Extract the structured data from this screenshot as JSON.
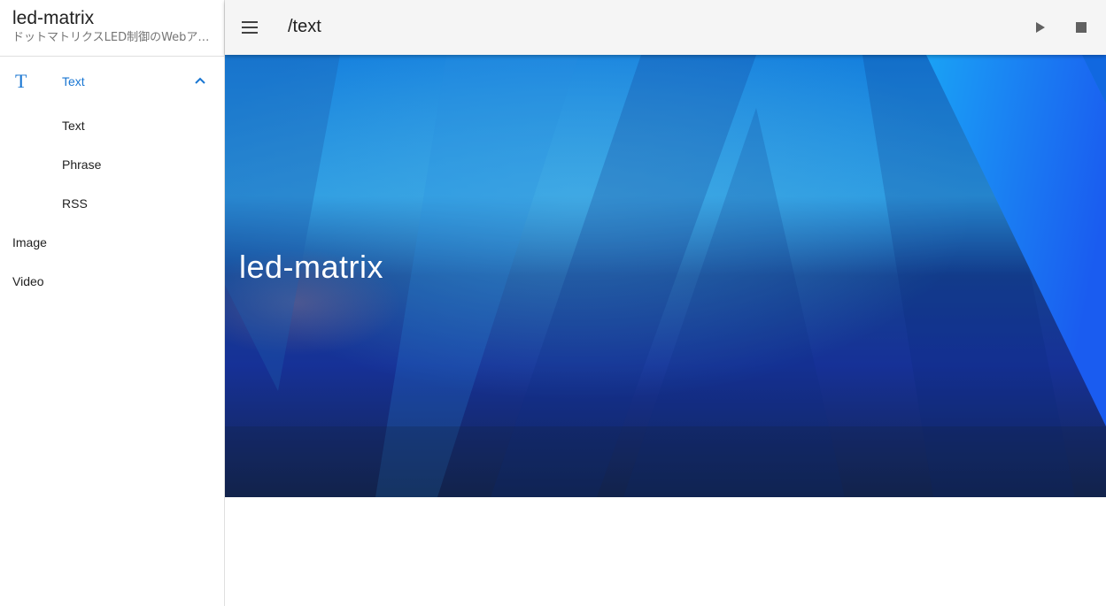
{
  "app": {
    "title": "led-matrix",
    "subtitle": "ドットマトリクスLED制御のWebアプリ"
  },
  "sidebar": {
    "group": {
      "icon": "text-icon",
      "icon_glyph": "T",
      "label": "Text",
      "expanded": true,
      "children": [
        {
          "label": "Text"
        },
        {
          "label": "Phrase"
        },
        {
          "label": "RSS"
        }
      ]
    },
    "items": [
      {
        "label": "Image"
      },
      {
        "label": "Video"
      }
    ]
  },
  "appbar": {
    "menu_icon": "menu-icon",
    "route": "/text",
    "play_icon": "play-icon",
    "stop_icon": "stop-icon"
  },
  "hero": {
    "title": "led-matrix"
  },
  "colors": {
    "accent": "#1976d2",
    "appbar_bg": "#f5f5f5",
    "hero_dark": "#13244f",
    "hero_light": "#2e9ee6"
  }
}
